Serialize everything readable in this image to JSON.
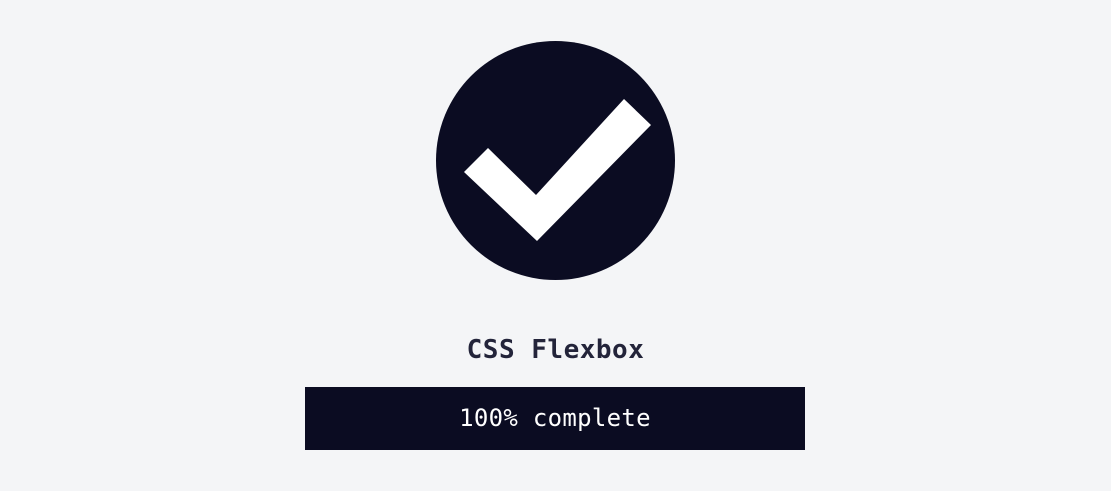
{
  "badge": {
    "icon": "checkmark-icon",
    "color": "#0b0c22"
  },
  "course": {
    "title": "CSS Flexbox"
  },
  "progress": {
    "label": "100% complete",
    "fraction": 1.0,
    "fill_color": "#0b0c22"
  }
}
